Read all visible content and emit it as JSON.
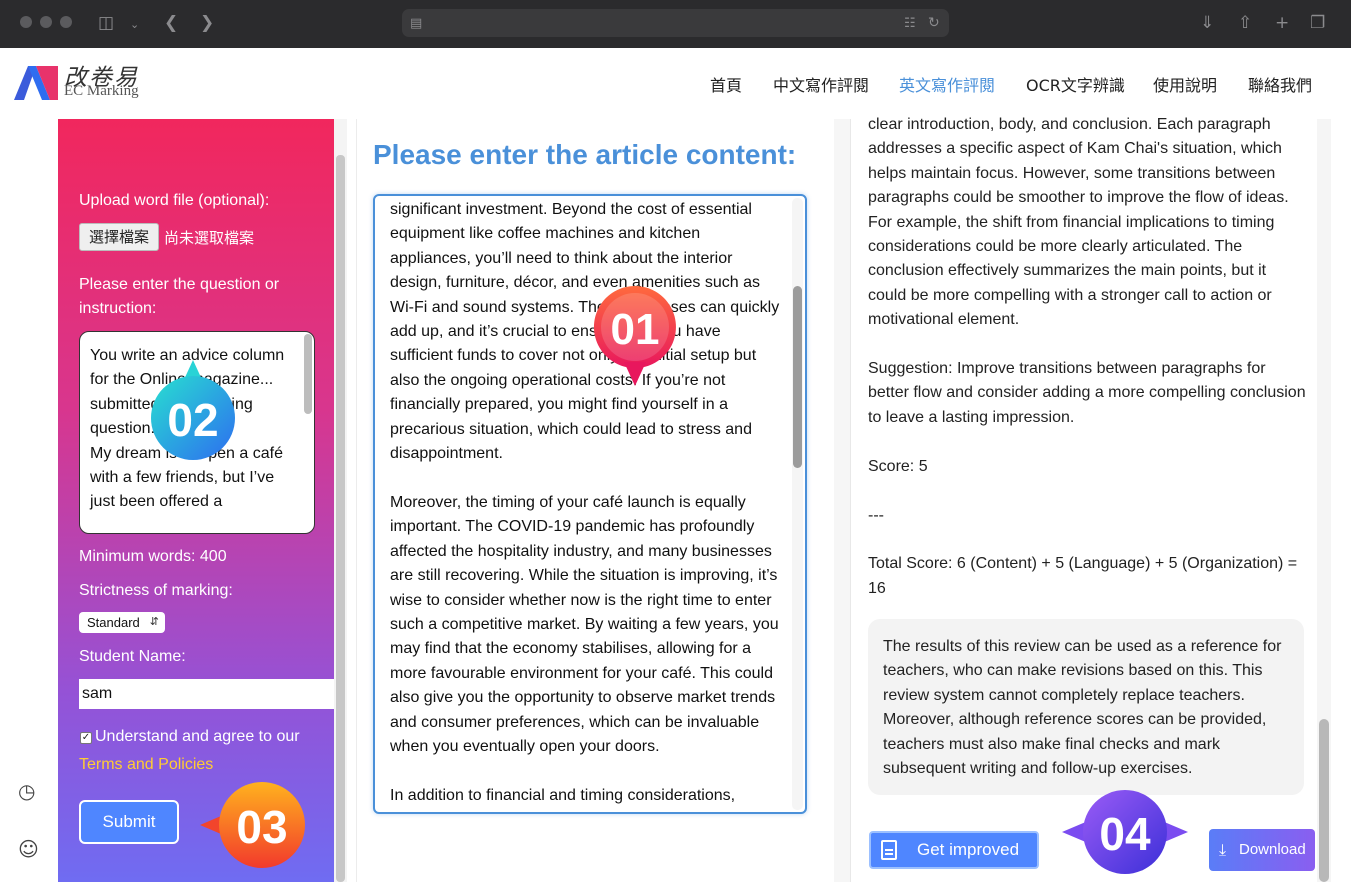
{
  "site": {
    "logo_cn": "改卷易",
    "logo_en": "EC Marking"
  },
  "nav": [
    {
      "label": "首頁"
    },
    {
      "label": "中文寫作評閱"
    },
    {
      "label": "英文寫作評閱"
    },
    {
      "label": "OCR文字辨識"
    },
    {
      "label": "使用說明"
    },
    {
      "label": "聯絡我們"
    }
  ],
  "nav_active_index": 2,
  "form": {
    "upload_label": "Upload word file (optional):",
    "file_button": "選擇檔案",
    "file_status": "尚未選取檔案",
    "question_label": "Please enter the question or instruction:",
    "question_text": "You write an advice column for the Online magazine... submitted the following question:\nMy dream is to open a café with a few friends, but I’ve just been offered a",
    "min_words": "Minimum words: 400",
    "strictness_label": "Strictness of marking:",
    "strictness_value": "Standard",
    "student_label": "Student Name:",
    "student_value": "sam",
    "agree_label": "Understand and agree to our",
    "terms_link": "Terms and Policies",
    "submit": "Submit"
  },
  "article": {
    "title": "Please enter the article content:",
    "text": "significant investment. Beyond the cost of essential equipment like coffee machines and kitchen appliances, you’ll need to think about the interior design, furniture, décor, and even amenities such as Wi-Fi and sound systems. These expenses can quickly add up, and it’s crucial to ensure that you have sufficient funds to cover not only the initial setup but also the ongoing operational costs. If you’re not financially prepared, you might find yourself in a precarious situation, which could lead to stress and disappointment.\n\nMoreover, the timing of your café launch is equally important. The COVID-19 pandemic has profoundly affected the hospitality industry, and many businesses are still recovering. While the situation is improving, it’s wise to consider whether now is the right time to enter such a competitive market. By waiting a few years, you may find that the economy stabilises, allowing for a more favourable environment for your café. This could also give you the opportunity to observe market trends and consumer preferences, which can be invaluable when you eventually open your doors.\n\nIn addition to financial and timing considerations,"
  },
  "result": {
    "text": "clear introduction, body, and conclusion. Each paragraph addresses a specific aspect of Kam Chai's situation, which helps maintain focus. However, some transitions between paragraphs could be smoother to improve the flow of ideas. For example, the shift from financial implications to timing considerations could be more clearly articulated. The conclusion effectively summarizes the main points, but it could be more compelling with a stronger call to action or motivational element.\n\nSuggestion: Improve transitions between paragraphs for better flow and consider adding a more compelling conclusion to leave a lasting impression.\n\nScore: 5\n\n---\n\nTotal Score: 6 (Content) + 5 (Language) + 5 (Organization) = 16",
    "disclaimer": "The results of this review can be used as a reference for teachers, who can make revisions based on this. This review system cannot completely replace teachers. Moreover, although reference scores can be provided, teachers must also make final checks and mark subsequent writing and follow-up exercises.",
    "improve_button": "Get improved",
    "download_button": "Download"
  },
  "badges": {
    "b1": "01",
    "b2": "02",
    "b3": "03",
    "b4": "04"
  },
  "colors": {
    "accent": "#4a90d9",
    "button": "#4f86ff",
    "terms": "#ffcc33",
    "gradient_top": "#f1275d",
    "gradient_bottom": "#6f6cf2"
  },
  "icons": {
    "history": "history-icon",
    "user": "user-icon",
    "document": "document-icon",
    "download": "download-icon"
  }
}
